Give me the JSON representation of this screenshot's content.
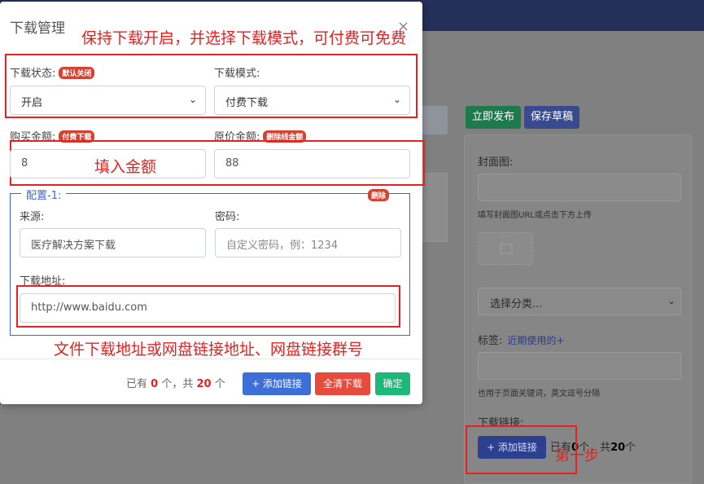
{
  "modal": {
    "title": "下载管理",
    "close": "×",
    "annotation_top": "保持下载开启，并选择下载模式，可付费可免费",
    "download_status": {
      "label": "下载状态:",
      "badge": "默认关闭",
      "value": "开启"
    },
    "download_mode": {
      "label": "下载模式:",
      "value": "付费下载"
    },
    "price": {
      "label": "购买金额:",
      "badge": "付费下载",
      "value": "8"
    },
    "original_price": {
      "label": "原价金额:",
      "badge": "删除线金额",
      "value": "88"
    },
    "annotation_amount": "填入金额",
    "config": {
      "legend": "配置-1:",
      "delete": "删除",
      "source_label": "来源:",
      "source_value": "医疗解决方案下载",
      "password_label": "密码:",
      "password_placeholder": "自定义密码，例：1234",
      "url_label": "下载地址:",
      "url_value": "http://www.baidu.com"
    },
    "annotation_url": "文件下载地址或网盘链接地址、网盘链接群号",
    "footer": {
      "count_prefix": "已有",
      "count_have": "0",
      "count_mid": "个，共",
      "count_total": "20",
      "count_suffix": "个",
      "add_label": "+ 添加链接",
      "clear_label": "全清下载",
      "ok_label": "确定"
    }
  },
  "background": {
    "publish_label": "立即发布",
    "draft_label": "保存草稿",
    "cover_label": "封面图:",
    "cover_hint": "填写封面图URL或点击下方上传",
    "category_select": "选择分类...",
    "tags_label": "标签:",
    "recent_link": "近期使用的+",
    "tags_hint": "也用于页面关键词，英文逗号分隔",
    "download_links_label": "下载链接:",
    "add_link": "+ 添加链接",
    "count_prefix": "已有",
    "count_have": "0",
    "count_mid": "个，共",
    "count_total": "20",
    "count_suffix": "个",
    "annotation_step": "第一步"
  },
  "colors": {
    "annotation_red": "#e82020",
    "primary_blue": "#3d6fd9",
    "danger_red": "#e64b3c",
    "success_green": "#1db87a"
  }
}
